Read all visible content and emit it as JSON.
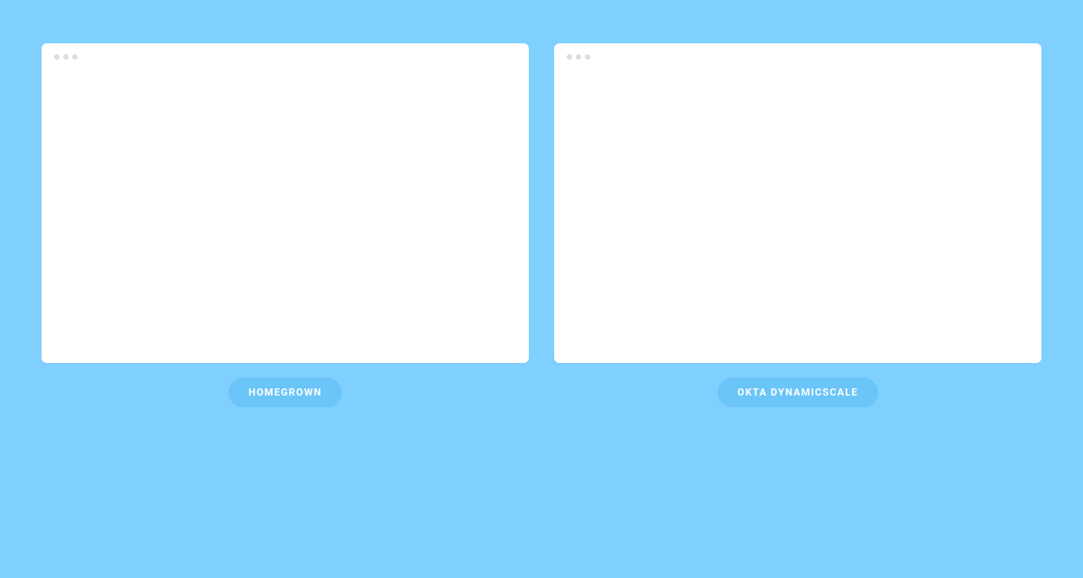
{
  "panels": [
    {
      "label": "HOMEGROWN"
    },
    {
      "label": "OKTA DYNAMICSCALE"
    }
  ],
  "colors": {
    "background": "#7FD0FF",
    "window": "#FFFFFF",
    "pill": "#6BC5F8",
    "pill_text": "#FFFFFF",
    "dot": "#DDDDDD"
  }
}
